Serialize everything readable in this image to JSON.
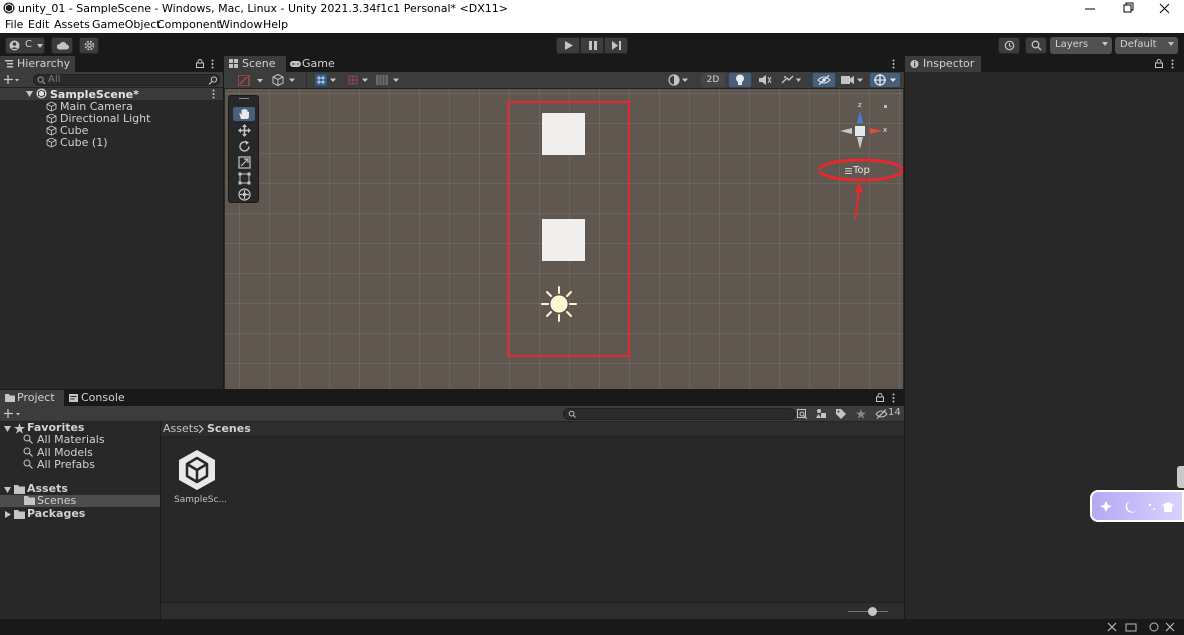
{
  "window": {
    "title": "unity_01 - SampleScene - Windows, Mac, Linux - Unity 2021.3.34f1c1 Personal* <DX11>"
  },
  "menu": [
    "File",
    "Edit",
    "Assets",
    "GameObject",
    "Component",
    "Window",
    "Help"
  ],
  "toolbar": {
    "account_label": "C",
    "layers_label": "Layers",
    "layout_label": "Default"
  },
  "hierarchy": {
    "tab_label": "Hierarchy",
    "search_placeholder": "All",
    "scene_name": "SampleScene*",
    "items": [
      "Main Camera",
      "Directional Light",
      "Cube",
      "Cube (1)"
    ]
  },
  "scene": {
    "tab_scene": "Scene",
    "tab_game": "Game",
    "mode_2d": "2D",
    "gizmo_label": "Top",
    "gizmo_axes": {
      "z": "z",
      "x": "x"
    }
  },
  "inspector": {
    "tab_label": "Inspector"
  },
  "project": {
    "tab_project": "Project",
    "tab_console": "Console",
    "hidden_count": "14",
    "favorites_label": "Favorites",
    "favorites": [
      "All Materials",
      "All Models",
      "All Prefabs"
    ],
    "assets_label": "Assets",
    "assets_children": [
      "Scenes"
    ],
    "packages_label": "Packages",
    "breadcrumb": [
      "Assets",
      "Scenes"
    ],
    "files": [
      {
        "name": "SampleSc..."
      }
    ]
  },
  "colors": {
    "annotation_red": "#e8282c",
    "panel_bg": "#282828",
    "tab_active": "#3c3c3c",
    "scene_bg": "#605850",
    "selection_blue": "#2c5d87"
  }
}
